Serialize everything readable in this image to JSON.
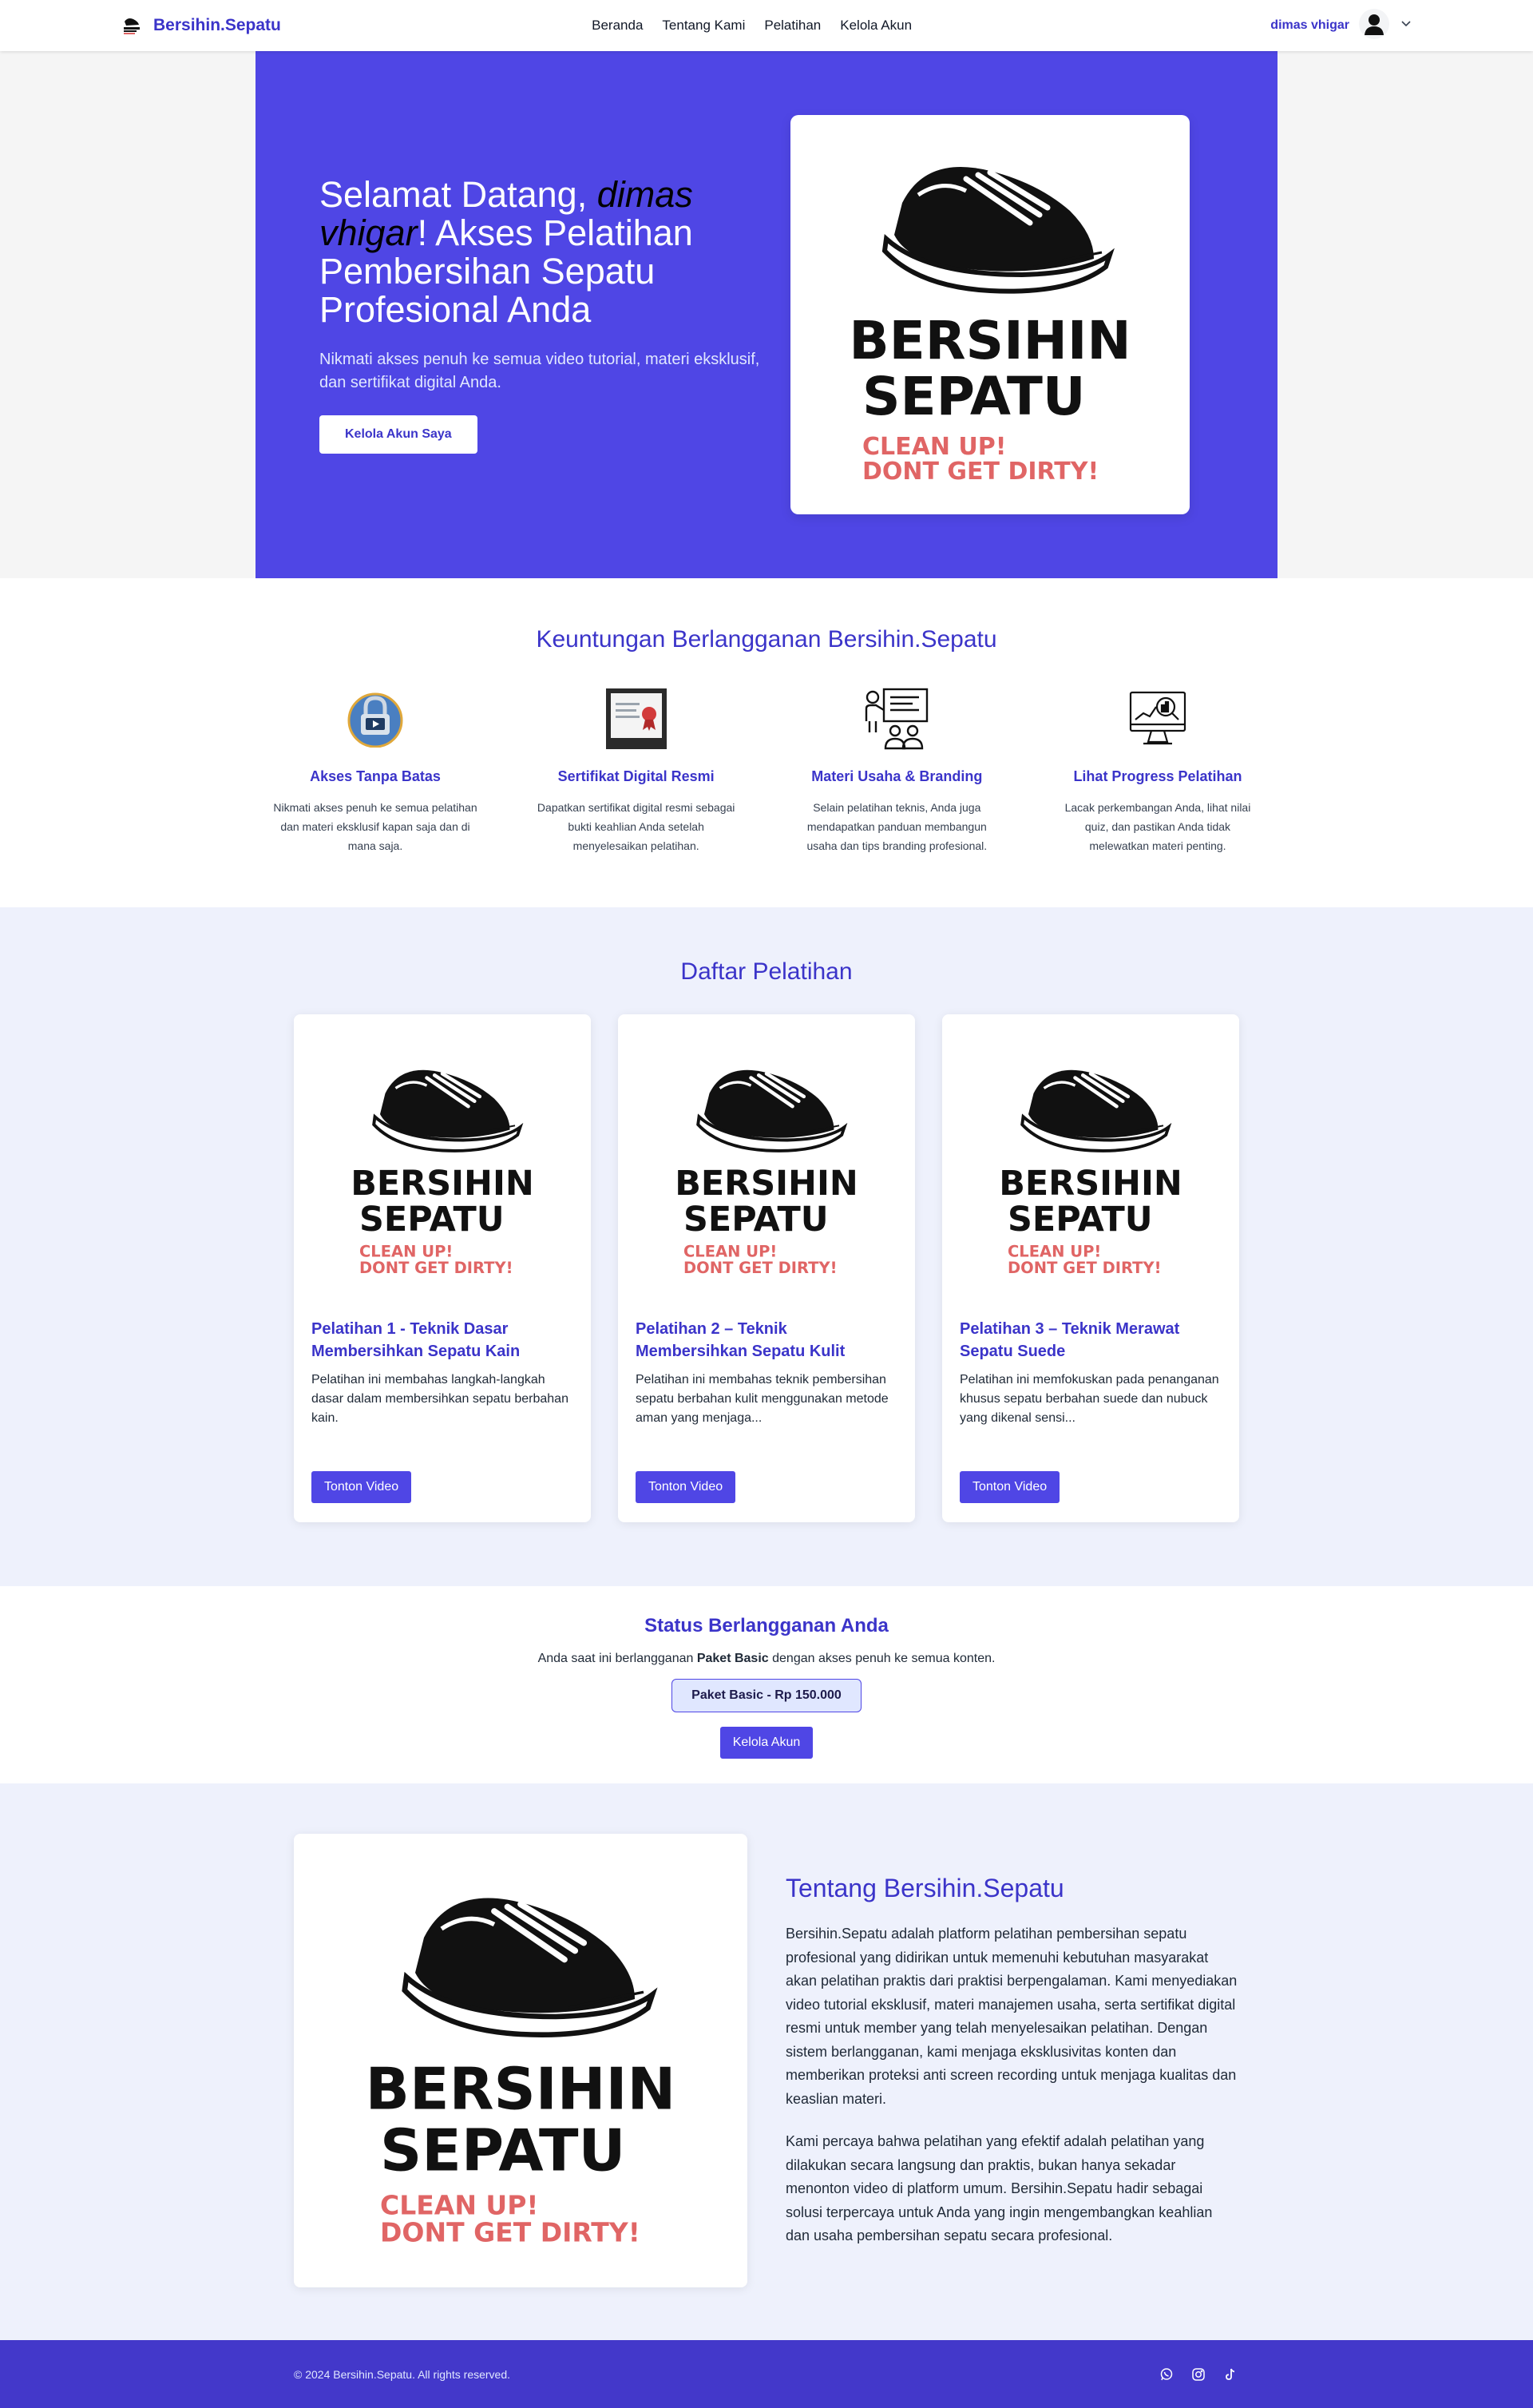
{
  "nav": {
    "brand": "Bersihin.Sepatu",
    "links": [
      "Beranda",
      "Tentang Kami",
      "Pelatihan",
      "Kelola Akun"
    ],
    "user_name": "dimas vhigar"
  },
  "logo": {
    "line1": "BERSIHIN",
    "line2": "SEPATU",
    "tag1": "CLEAN UP!",
    "tag2": "DONT GET DIRTY!",
    "text_color": "#111111",
    "tag_color": "#e06565"
  },
  "hero": {
    "title_pre": "Selamat Datang, ",
    "title_name": "dimas vhigar",
    "title_post": "! Akses Pelatihan Pembersihan Sepatu Profesional Anda",
    "subtitle": "Nikmati akses penuh ke semua video tutorial, materi eksklusif, dan sertifikat digital Anda.",
    "button": "Kelola Akun Saya",
    "bg_color": "#4f46e5"
  },
  "benefits": {
    "title": "Keuntungan Berlangganan Bersihin.Sepatu",
    "items": [
      {
        "icon": "locked-video-icon",
        "title": "Akses Tanpa Batas",
        "desc": "Nikmati akses penuh ke semua pelatihan dan materi eksklusif kapan saja dan di mana saja."
      },
      {
        "icon": "certificate-icon",
        "title": "Sertifikat Digital Resmi",
        "desc": "Dapatkan sertifikat digital resmi sebagai bukti keahlian Anda setelah menyelesaikan pelatihan."
      },
      {
        "icon": "presentation-icon",
        "title": "Materi Usaha & Branding",
        "desc": "Selain pelatihan teknis, Anda juga mendapatkan panduan membangun usaha dan tips branding profesional."
      },
      {
        "icon": "progress-monitor-icon",
        "title": "Lihat Progress Pelatihan",
        "desc": "Lacak perkembangan Anda, lihat nilai quiz, dan pastikan Anda tidak melewatkan materi penting."
      }
    ]
  },
  "courses": {
    "title": "Daftar Pelatihan",
    "items": [
      {
        "title": "Pelatihan 1 - Teknik Dasar Membersihkan Sepatu Kain",
        "desc": "Pelatihan ini membahas langkah-langkah dasar dalam membersihkan sepatu berbahan kain.",
        "button": "Tonton Video"
      },
      {
        "title": "Pelatihan 2 – Teknik Membersihkan Sepatu Kulit",
        "desc": "Pelatihan ini membahas teknik pembersihan sepatu berbahan kulit menggunakan metode aman yang menjaga...",
        "button": "Tonton Video"
      },
      {
        "title": "Pelatihan 3 – Teknik Merawat Sepatu Suede",
        "desc": "Pelatihan ini memfokuskan pada penanganan khusus sepatu berbahan suede dan nubuck yang dikenal sensi...",
        "button": "Tonton Video"
      }
    ]
  },
  "status": {
    "title": "Status Berlangganan Anda",
    "text_pre": "Anda saat ini berlangganan ",
    "plan_name": "Paket Basic",
    "text_post": " dengan akses penuh ke semua konten.",
    "badge": "Paket Basic - Rp 150.000",
    "button": "Kelola Akun"
  },
  "about": {
    "title": "Tentang Bersihin.Sepatu",
    "p1": "Bersihin.Sepatu adalah platform pelatihan pembersihan sepatu profesional yang didirikan untuk memenuhi kebutuhan masyarakat akan pelatihan praktis dari praktisi berpengalaman. Kami menyediakan video tutorial eksklusif, materi manajemen usaha, serta sertifikat digital resmi untuk member yang telah menyelesaikan pelatihan. Dengan sistem berlangganan, kami menjaga eksklusivitas konten dan memberikan proteksi anti screen recording untuk menjaga kualitas dan keaslian materi.",
    "p2": "Kami percaya bahwa pelatihan yang efektif adalah pelatihan yang dilakukan secara langsung dan praktis, bukan hanya sekadar menonton video di platform umum. Bersihin.Sepatu hadir sebagai solusi terpercaya untuk Anda yang ingin mengembangkan keahlian dan usaha pembersihan sepatu secara profesional."
  },
  "footer": {
    "copyright": "© 2024 Bersihin.Sepatu. All rights reserved.",
    "socials": [
      "whatsapp-icon",
      "instagram-icon",
      "tiktok-icon"
    ]
  },
  "colors": {
    "accent": "#4f46e5",
    "brand_text": "#3b34c9",
    "section_bg": "#eef1fc",
    "footer_bg": "#4338ca"
  }
}
